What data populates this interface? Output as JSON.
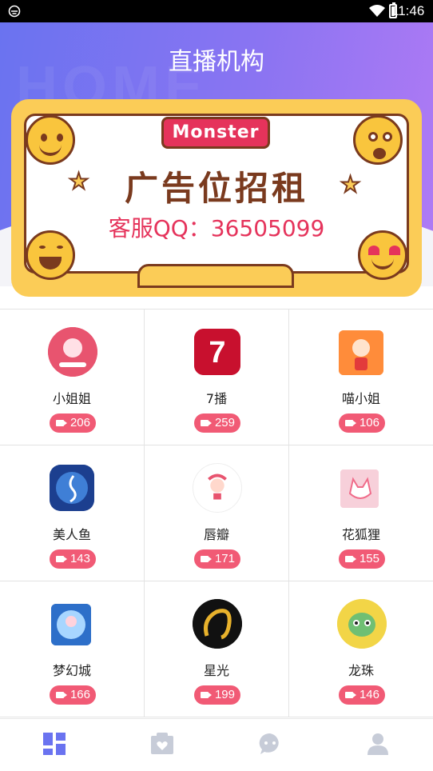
{
  "status_bar": {
    "time": "11:46"
  },
  "header": {
    "title": "直播机构",
    "watermark": "HOME"
  },
  "banner": {
    "tab_label": "Monster",
    "headline": "广告位招租",
    "contact": "客服QQ：36505099"
  },
  "platforms": [
    {
      "name": "小姐姐",
      "count": "206",
      "logo_color": "#ff7b9c"
    },
    {
      "name": "7播",
      "count": "259",
      "logo_color": "#d3142b"
    },
    {
      "name": "喵小姐",
      "count": "106",
      "logo_color": "#ff7a2f"
    },
    {
      "name": "美人鱼",
      "count": "143",
      "logo_color": "#1e4fa8"
    },
    {
      "name": "唇瓣",
      "count": "171",
      "logo_color": "#ffffff"
    },
    {
      "name": "花狐狸",
      "count": "155",
      "logo_color": "#f7c8d4"
    },
    {
      "name": "梦幻城",
      "count": "166",
      "logo_color": "#2d7bd4"
    },
    {
      "name": "星光",
      "count": "199",
      "logo_color": "#111111"
    },
    {
      "name": "龙珠",
      "count": "146",
      "logo_color": "#f2d547"
    }
  ],
  "tabbar": {
    "items": [
      {
        "icon": "grid-icon",
        "active": true
      },
      {
        "icon": "heart-card-icon",
        "active": false
      },
      {
        "icon": "chat-icon",
        "active": false
      },
      {
        "icon": "user-icon",
        "active": false
      }
    ],
    "active_color": "#6a73f0",
    "inactive_color": "#c7ccd8"
  }
}
